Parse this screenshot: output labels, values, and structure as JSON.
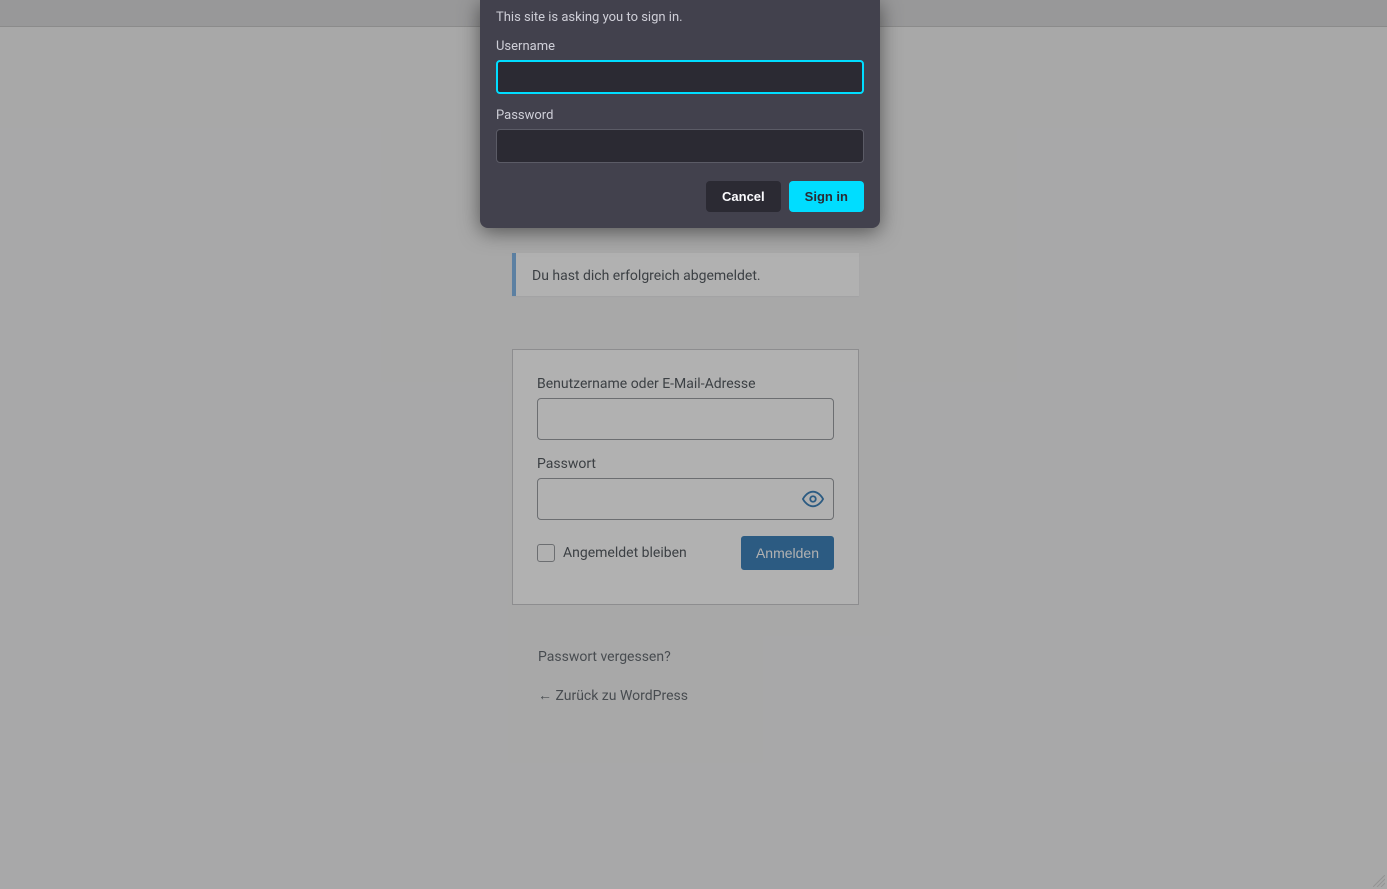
{
  "auth_dialog": {
    "message": "This site is asking you to sign in.",
    "username_label": "Username",
    "username_value": "",
    "password_label": "Password",
    "password_value": "",
    "cancel_label": "Cancel",
    "signin_label": "Sign in"
  },
  "notice": {
    "text": "Du hast dich erfolgreich abgemeldet."
  },
  "login_form": {
    "username_label": "Benutzername oder E-Mail-Adresse",
    "username_value": "",
    "password_label": "Passwort",
    "password_value": "",
    "remember_label": "Angemeldet bleiben",
    "submit_label": "Anmelden"
  },
  "links": {
    "forgot": "Passwort vergessen?",
    "back": "← Zurück zu WordPress"
  }
}
